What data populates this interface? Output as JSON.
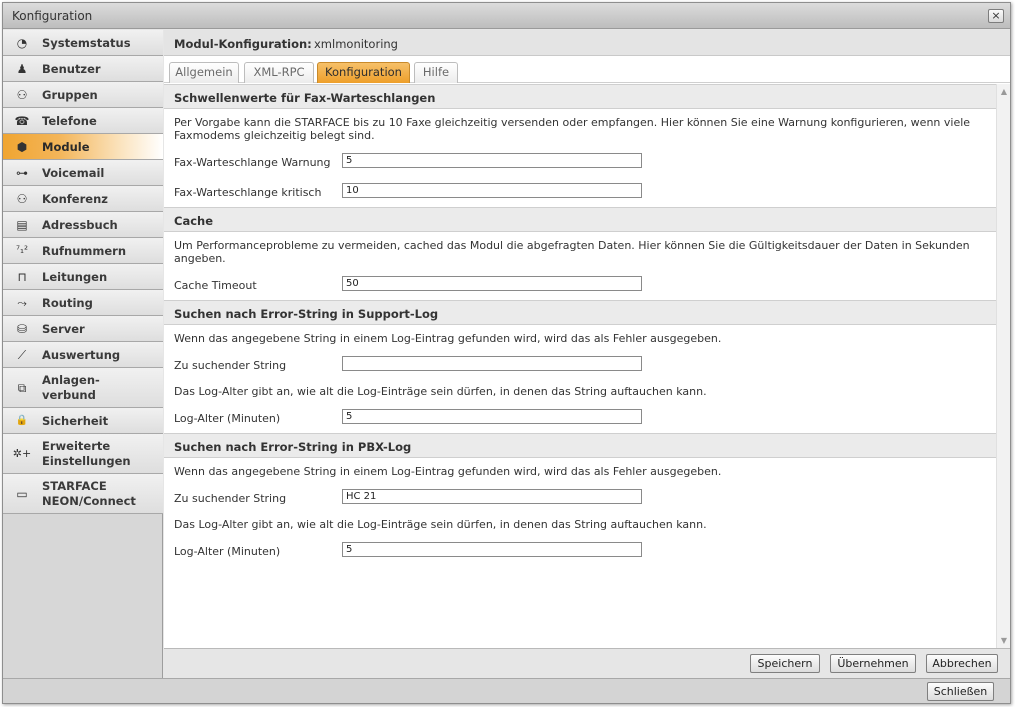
{
  "window": {
    "title": "Konfiguration",
    "close_symbol": "×"
  },
  "sidebar": {
    "items": [
      {
        "label": "Systemstatus",
        "icon": "gauge-icon",
        "glyph": "◔"
      },
      {
        "label": "Benutzer",
        "icon": "user-icon",
        "glyph": "♟"
      },
      {
        "label": "Gruppen",
        "icon": "group-icon",
        "glyph": "⚇"
      },
      {
        "label": "Telefone",
        "icon": "phone-icon",
        "glyph": "☎"
      },
      {
        "label": "Module",
        "icon": "module-cube-icon",
        "glyph": "⬢"
      },
      {
        "label": "Voicemail",
        "icon": "voicemail-icon",
        "glyph": "⊶"
      },
      {
        "label": "Konferenz",
        "icon": "conference-icon",
        "glyph": "⚇"
      },
      {
        "label": "Adressbuch",
        "icon": "addressbook-icon",
        "glyph": "▤"
      },
      {
        "label": "Rufnummern",
        "icon": "numbers-icon",
        "glyph": "⁷₁²"
      },
      {
        "label": "Leitungen",
        "icon": "lines-icon",
        "glyph": "⊓"
      },
      {
        "label": "Routing",
        "icon": "routing-icon",
        "glyph": "⤳"
      },
      {
        "label": "Server",
        "icon": "server-icon",
        "glyph": "⛁"
      },
      {
        "label": "Auswertung",
        "icon": "chart-icon",
        "glyph": "⟋"
      },
      {
        "label_line1": "Anlagen-",
        "label_line2": "verbund",
        "icon": "network-icon",
        "glyph": "⧉"
      },
      {
        "label": "Sicherheit",
        "icon": "lock-icon",
        "glyph": "🔒"
      },
      {
        "label_line1": "Erweiterte",
        "label_line2": "Einstellungen",
        "icon": "advanced-settings-icon",
        "glyph": "✲+"
      },
      {
        "label_line1": "STARFACE",
        "label_line2": "NEON/Connect",
        "icon": "video-icon",
        "glyph": "▭"
      }
    ]
  },
  "main": {
    "module_label": "Modul-Konfiguration:",
    "module_name": "xmlmonitoring",
    "tabs": [
      "Allgemein",
      "XML-RPC",
      "Konfiguration",
      "Hilfe"
    ],
    "active_tab": "Konfiguration"
  },
  "sections": {
    "fax": {
      "title": "Schwellenwerte für Fax-Warteschlangen",
      "desc": "Per Vorgabe kann die STARFACE bis zu 10 Faxe gleichzeitig versenden oder empfangen. Hier können Sie eine Warnung konfigurieren, wenn viele Faxmodems gleichzeitig belegt sind.",
      "warn_label": "Fax-Warteschlange Warnung",
      "warn_value": "5",
      "crit_label": "Fax-Warteschlange kritisch",
      "crit_value": "10"
    },
    "cache": {
      "title": "Cache",
      "desc": "Um Performanceprobleme zu vermeiden, cached das Modul die abgefragten Daten. Hier können Sie die Gültigkeitsdauer der Daten in Sekunden angeben.",
      "timeout_label": "Cache Timeout",
      "timeout_value": "50"
    },
    "support_log": {
      "title": "Suchen nach Error-String in Support-Log",
      "desc": "Wenn das angegebene String in einem Log-Eintrag gefunden wird, wird das als Fehler ausgegeben.",
      "string_label": "Zu suchender String",
      "string_value": "",
      "age_desc": "Das Log-Alter gibt an, wie alt die Log-Einträge sein dürfen, in denen das String auftauchen kann.",
      "age_label": "Log-Alter (Minuten)",
      "age_value": "5"
    },
    "pbx_log": {
      "title": "Suchen nach Error-String in PBX-Log",
      "desc": "Wenn das angegebene String in einem Log-Eintrag gefunden wird, wird das als Fehler ausgegeben.",
      "string_label": "Zu suchender String",
      "string_value": "HC 21",
      "age_desc": "Das Log-Alter gibt an, wie alt die Log-Einträge sein dürfen, in denen das String auftauchen kann.",
      "age_label": "Log-Alter (Minuten)",
      "age_value": "5"
    }
  },
  "footer": {
    "save": "Speichern",
    "apply": "Übernehmen",
    "cancel": "Abbrechen"
  },
  "bottom": {
    "close": "Schließen"
  },
  "scroll": {
    "up": "▲",
    "down": "▼"
  },
  "colors": {
    "accent": "#f0a531",
    "header_bg": "#e4e4e4"
  }
}
